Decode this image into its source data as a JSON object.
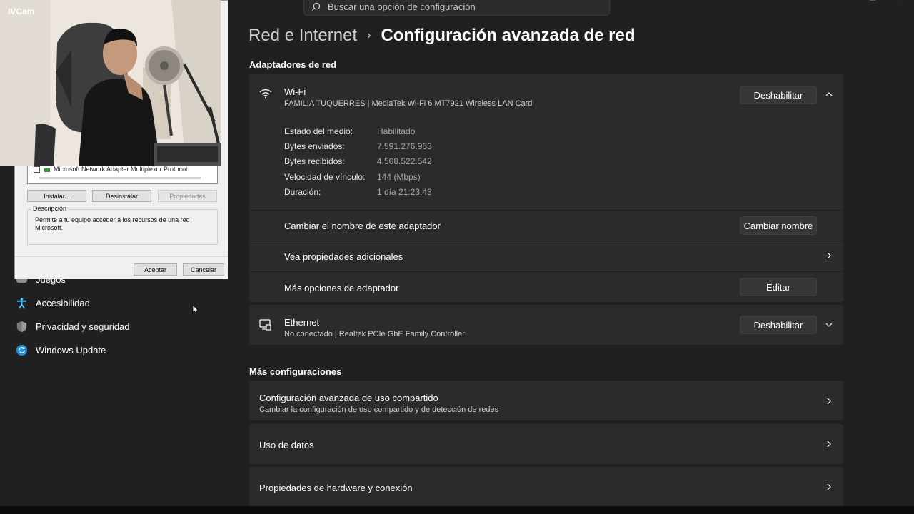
{
  "search": {
    "placeholder": "Buscar una opción de configuración"
  },
  "header": {
    "parent": "Red e Internet",
    "separator": "›",
    "title": "Configuración avanzada de red"
  },
  "adapters": {
    "section_title": "Adaptadores de red",
    "wifi": {
      "name": "Wi-Fi",
      "description": "FAMILIA TUQUERRES | MediaTek Wi-Fi 6 MT7921 Wireless LAN Card",
      "disable_label": "Deshabilitar",
      "properties": [
        {
          "key": "Estado del medio:",
          "value": "Habilitado"
        },
        {
          "key": "Bytes enviados:",
          "value": "7.591.276.963"
        },
        {
          "key": "Bytes recibidos:",
          "value": "4.508.522.542"
        },
        {
          "key": "Velocidad de vínculo:",
          "value": "144 (Mbps)"
        },
        {
          "key": "Duración:",
          "value": "1 día 21:23:43"
        }
      ],
      "rename_label": "Cambiar el nombre de este adaptador",
      "rename_button": "Cambiar nombre",
      "more_props_label": "Vea propiedades adicionales",
      "more_options_label": "Más opciones de adaptador",
      "edit_button": "Editar"
    },
    "ethernet": {
      "name": "Ethernet",
      "description": "No conectado | Realtek PCIe GbE Family Controller",
      "disable_label": "Deshabilitar"
    }
  },
  "more": {
    "section_title": "Más configuraciones",
    "items": [
      {
        "title": "Configuración avanzada de uso compartido",
        "subtitle": "Cambiar la configuración de uso compartido y de detección de redes"
      },
      {
        "title": "Uso de datos"
      },
      {
        "title": "Propiedades de hardware y conexión"
      }
    ]
  },
  "sidebar": {
    "items": [
      {
        "label": "Juegos",
        "icon": "gamepad-icon"
      },
      {
        "label": "Accesibilidad",
        "icon": "accessibility-icon"
      },
      {
        "label": "Privacidad y seguridad",
        "icon": "shield-icon"
      },
      {
        "label": "Windows Update",
        "icon": "update-icon"
      }
    ]
  },
  "dialog": {
    "list_item": "Microsoft Network Adapter Multiplexor Protocol",
    "install": "Instalar...",
    "uninstall": "Desinstalar",
    "properties": "Propiedades",
    "description_legend": "Descripción",
    "description_text": "Permite a tu equipo acceder a los recursos de una red Microsoft.",
    "ok": "Aceptar",
    "cancel": "Cancelar"
  },
  "webcam": {
    "label": "IVCam"
  },
  "colors": {
    "background": "#202020",
    "card": "#2b2b2b",
    "button": "#373737",
    "accent": "#4cc2ff"
  }
}
